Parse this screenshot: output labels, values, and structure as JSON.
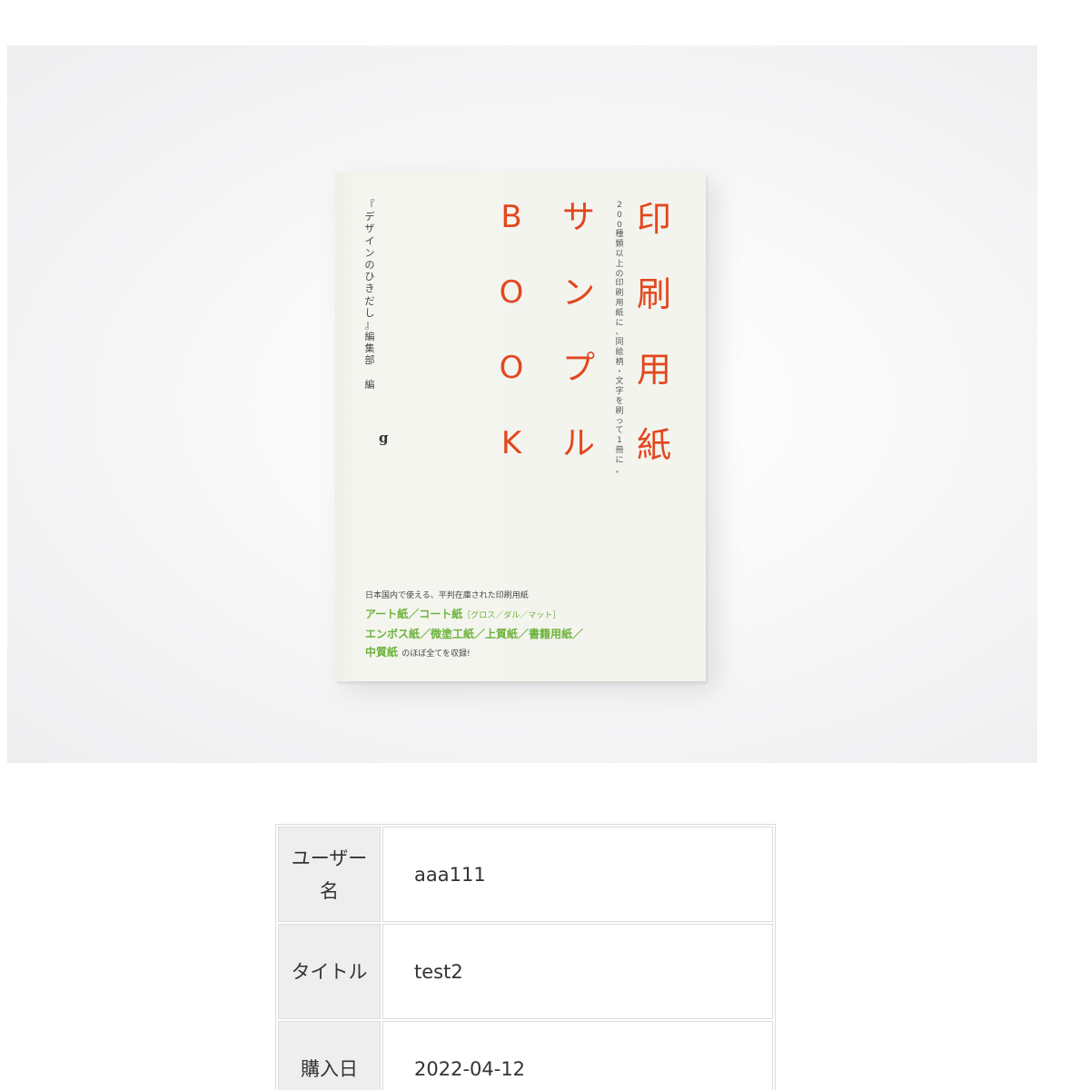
{
  "product_image": {
    "book_cover": {
      "title_kanji": [
        "印",
        "刷",
        "用",
        "紙"
      ],
      "title_katakana": [
        "サ",
        "ン",
        "プ",
        "ル"
      ],
      "title_latin": [
        "B",
        "O",
        "O",
        "K"
      ],
      "subtitle": "200種類以上の印刷用紙に、同絵柄・文字を刷って1冊に。",
      "editor": "『デザインのひきだし』編集部 編",
      "publisher_mark": "g",
      "blurb_line1": "日本国内で使える、平判在庫された印刷用紙",
      "blurb_line2_main": "アート紙／コート紙",
      "blurb_line2_small": "［グロス／ダル／マット］",
      "blurb_line3": "エンボス紙／微塗工紙／上質紙／書籍用紙／",
      "blurb_line4_main": "中質紙",
      "blurb_line4_tail": "のほぼ全てを収録!"
    }
  },
  "details": {
    "rows": [
      {
        "label": "ユーザー名",
        "value": "aaa111"
      },
      {
        "label": "タイトル",
        "value": "test2"
      },
      {
        "label": "購入日",
        "value": "2022-04-12"
      }
    ]
  }
}
